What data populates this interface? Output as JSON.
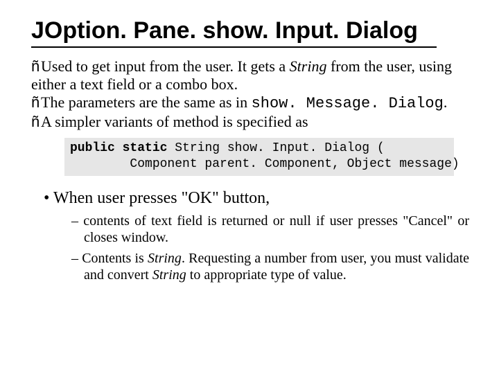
{
  "title_parts": {
    "pane": "JOption. Pane. ",
    "method": "show. Input. Dialog"
  },
  "para": {
    "arrow": "ñ",
    "l1_a": "Used to get input from the user. It gets a ",
    "string_word": "String",
    "l1_b": " from the user, using either a text field or a combo box.",
    "l2_a": "The parameters are the same as in ",
    "l2_mono": "show. Message. Dialog",
    "l2_b": ".",
    "l3": "A simpler variants of method is specified as"
  },
  "code": {
    "line1_kw": "public static",
    "line1_rest": " String show. Input. Dialog (",
    "line2": "        Component parent. Component, Object message)"
  },
  "bullet_main": "•  When user presses \"OK\" button,",
  "sub": {
    "a": "–  contents of text field is returned or null if user presses \"Cancel\" or closes window.",
    "b_a": "–  Contents is ",
    "b_i1": "String",
    "b_b": ". Requesting a number from user, you must validate and convert ",
    "b_i2": "String",
    "b_c": " to appropriate type of value."
  }
}
